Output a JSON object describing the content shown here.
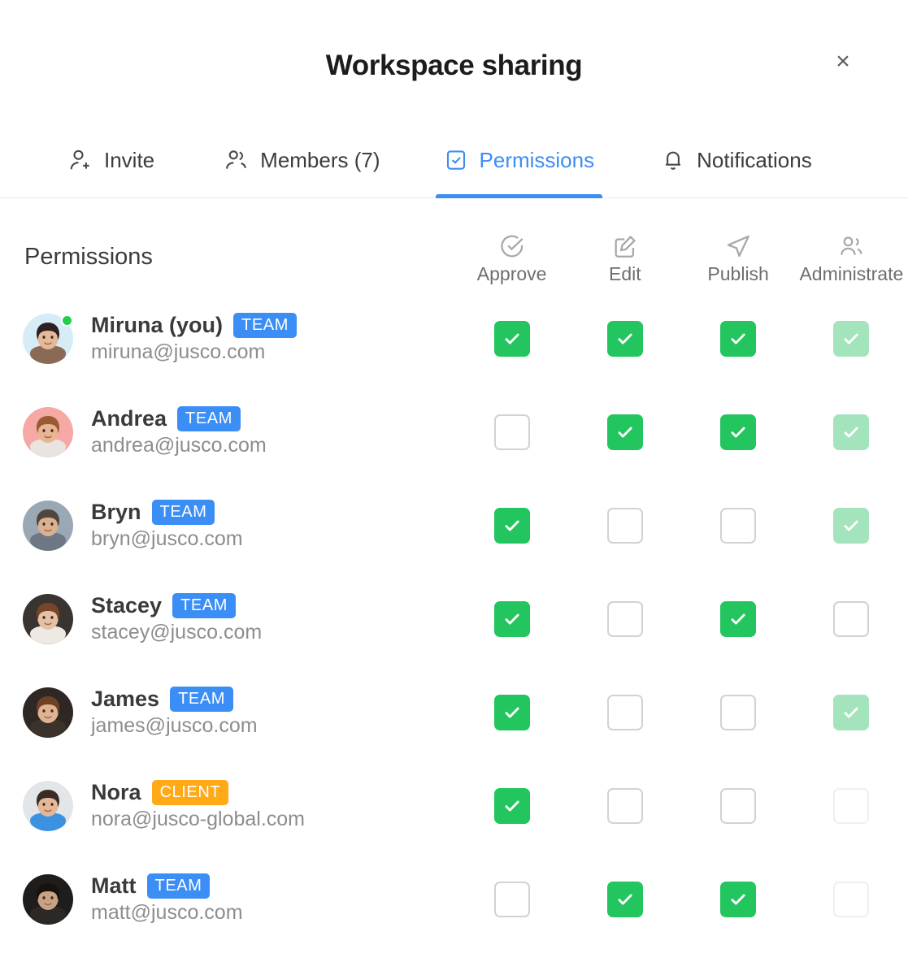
{
  "header": {
    "title": "Workspace sharing",
    "close_label": "×"
  },
  "tabs": [
    {
      "id": "invite",
      "label": "Invite",
      "icon": "user-plus-icon",
      "active": false
    },
    {
      "id": "members",
      "label": "Members (7)",
      "icon": "users-icon",
      "active": false
    },
    {
      "id": "permissions",
      "label": "Permissions",
      "icon": "checkbox-icon",
      "active": true
    },
    {
      "id": "notifications",
      "label": "Notifications",
      "icon": "bell-icon",
      "active": false
    }
  ],
  "section": {
    "title": "Permissions"
  },
  "columns": [
    {
      "id": "approve",
      "label": "Approve",
      "icon": "check-circle-icon"
    },
    {
      "id": "edit",
      "label": "Edit",
      "icon": "pencil-square-icon"
    },
    {
      "id": "publish",
      "label": "Publish",
      "icon": "paper-plane-icon"
    },
    {
      "id": "administrate",
      "label": "Administrate",
      "icon": "users-admin-icon"
    }
  ],
  "rows": [
    {
      "name": "Miruna (you)",
      "email": "miruna@jusco.com",
      "badge": "TEAM",
      "badge_type": "team",
      "online": true,
      "avatar_bg": "#d6ecf7",
      "avatar_skin": "#e7b89a",
      "avatar_hair": "#2b2120",
      "avatar_shirt": "#8a6a55",
      "permissions": [
        "checked",
        "checked",
        "checked",
        "checked-muted"
      ]
    },
    {
      "name": "Andrea",
      "email": "andrea@jusco.com",
      "badge": "TEAM",
      "badge_type": "team",
      "online": false,
      "avatar_bg": "#f6a9a4",
      "avatar_skin": "#e8b492",
      "avatar_hair": "#9a5a33",
      "avatar_shirt": "#e8e4e0",
      "permissions": [
        "empty",
        "checked",
        "checked",
        "checked-muted"
      ]
    },
    {
      "name": "Bryn",
      "email": "bryn@jusco.com",
      "badge": "TEAM",
      "badge_type": "team",
      "online": false,
      "avatar_bg": "#9aa7b4",
      "avatar_skin": "#dcb191",
      "avatar_hair": "#51463f",
      "avatar_shirt": "#6d7884",
      "permissions": [
        "checked",
        "empty",
        "empty",
        "checked-muted"
      ]
    },
    {
      "name": "Stacey",
      "email": "stacey@jusco.com",
      "badge": "TEAM",
      "badge_type": "team",
      "online": false,
      "avatar_bg": "#3a3431",
      "avatar_skin": "#e4c0a5",
      "avatar_hair": "#76452a",
      "avatar_shirt": "#efe9e4",
      "permissions": [
        "checked",
        "empty",
        "checked",
        "empty"
      ]
    },
    {
      "name": "James",
      "email": "james@jusco.com",
      "badge": "TEAM",
      "badge_type": "team",
      "online": false,
      "avatar_bg": "#2e2724",
      "avatar_skin": "#e0b292",
      "avatar_hair": "#6e4126",
      "avatar_shirt": "#3b322c",
      "permissions": [
        "checked",
        "empty",
        "empty",
        "checked-muted"
      ]
    },
    {
      "name": "Nora",
      "email": "nora@jusco-global.com",
      "badge": "CLIENT",
      "badge_type": "client",
      "online": false,
      "avatar_bg": "#e3e6e8",
      "avatar_skin": "#e5b79a",
      "avatar_hair": "#3a2b24",
      "avatar_shirt": "#3b92e0",
      "permissions": [
        "checked",
        "empty",
        "empty",
        "empty-muted"
      ]
    },
    {
      "name": "Matt",
      "email": "matt@jusco.com",
      "badge": "TEAM",
      "badge_type": "team",
      "online": false,
      "avatar_bg": "#1f1d1c",
      "avatar_skin": "#c9a184",
      "avatar_hair": "#17120f",
      "avatar_shirt": "#2b2826",
      "permissions": [
        "empty",
        "checked",
        "checked",
        "empty-muted"
      ]
    }
  ],
  "colors": {
    "accent_blue": "#3b8ef5",
    "check_green": "#22c55e",
    "check_green_muted": "#a3e4bd",
    "badge_client_orange": "#ffaa16",
    "online_green": "#21cf4b"
  }
}
